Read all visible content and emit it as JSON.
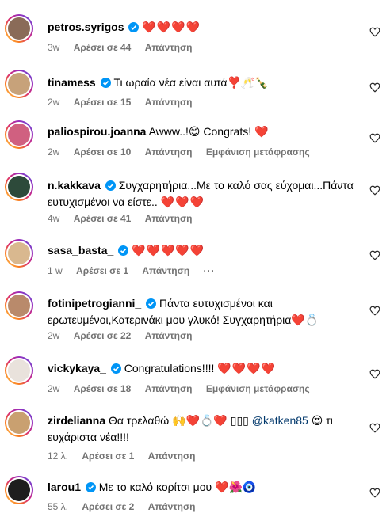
{
  "labels": {
    "reply": "Απάντηση",
    "see_translation": "Εμφάνιση μετάφρασης"
  },
  "colors": {
    "verified": "#0095f6",
    "heart": "#e8132b",
    "meta": "#737373",
    "mention": "#00376b"
  },
  "comments": [
    {
      "username": "petros.syrigos",
      "verified": true,
      "text": "",
      "emoji": "❤️❤️❤️❤️",
      "time": "3w",
      "likes": "Αρέσει σε 44",
      "translation": false,
      "avatar_color": "#8a6b58"
    },
    {
      "username": "tinamess",
      "verified": true,
      "text": "Τι ωραία νέα είναι αυτά",
      "emoji": "❣️🥂🍾",
      "time": "2w",
      "likes": "Αρέσει σε 15",
      "translation": false,
      "avatar_color": "#c7a27a"
    },
    {
      "username": "paliospirou.joanna",
      "verified": false,
      "text": "Awww..!",
      "emoji": "😊",
      "text2": " Congrats! ",
      "emoji2": "❤️",
      "time": "2w",
      "likes": "Αρέσει σε 10",
      "translation": true,
      "avatar_color": "#d06080"
    },
    {
      "username": "n.kakkava",
      "verified": true,
      "text": "Συγχαρητήρια...Με το καλό σας εύχομαι...Πάντα ευτυχισμένοι να είστε..",
      "emoji": "❤️❤️❤️",
      "time": "4w",
      "likes": "Αρέσει σε 41",
      "translation": false,
      "avatar_color": "#2d4a3a"
    },
    {
      "username": "sasa_basta_",
      "verified": true,
      "text": "",
      "emoji": "❤️❤️❤️❤️❤️",
      "time": "1 w",
      "likes": "Αρέσει σε 1",
      "translation": false,
      "more": "···",
      "avatar_color": "#d9b88f"
    },
    {
      "username": "fotinipetrogianni_",
      "verified": true,
      "text": "Πάντα ευτυχισμένοι και ερωτευμένοι,Κατερινάκι μου γλυκό! Συγχαρητήρια",
      "emoji": "❤️💍",
      "time": "2w",
      "likes": "Αρέσει σε 22",
      "translation": false,
      "avatar_color": "#b98a6b"
    },
    {
      "username": "vickykaya_",
      "verified": true,
      "text": "Congratulations!!!!",
      "emoji": "❤️❤️❤️❤️",
      "time": "2w",
      "likes": "Αρέσει σε 18",
      "translation": true,
      "avatar_color": "#e9e2dc"
    },
    {
      "username": "zirdelianna",
      "verified": false,
      "text": "Θα τρελαθώ",
      "emoji": "🙌❤️💍❤️",
      "boxes": "▯▯▯",
      "mention": "@katken85",
      "emoji2": "😍",
      "text2": " τι ευχάριστα νέα!!!!",
      "time": "12 λ.",
      "likes": "Αρέσει σε 1",
      "translation": false,
      "avatar_color": "#c9a070"
    },
    {
      "username": "larou1",
      "verified": true,
      "text": "Με το καλό κορίτσι μου",
      "emoji": "❤️🌺🧿",
      "time": "55 λ.",
      "likes": "Αρέσει σε 2",
      "translation": false,
      "avatar_color": "#1e1e1e"
    }
  ]
}
